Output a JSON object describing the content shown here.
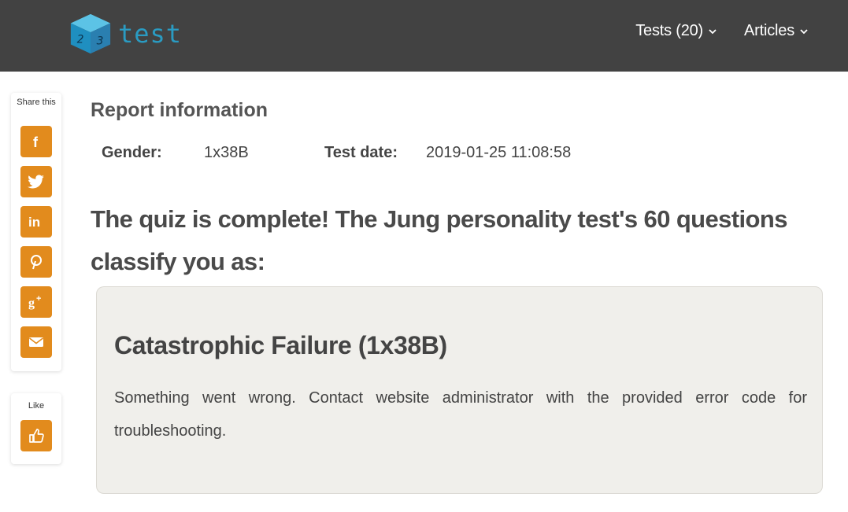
{
  "header": {
    "logo_text": "test",
    "logo_digits": [
      "2",
      "3"
    ],
    "nav": [
      {
        "label": "Tests (20)",
        "icon": "chevron-down-icon"
      },
      {
        "label": "Articles",
        "icon": "chevron-down-icon"
      }
    ],
    "background_color": "#424242",
    "logo_color": "#2a9bc2"
  },
  "share_sidebar": {
    "label": "Share this",
    "buttons": [
      {
        "name": "facebook",
        "icon": "facebook-icon"
      },
      {
        "name": "twitter",
        "icon": "twitter-icon"
      },
      {
        "name": "linkedin",
        "icon": "linkedin-icon"
      },
      {
        "name": "pinterest",
        "icon": "pinterest-icon"
      },
      {
        "name": "google-plus",
        "icon": "google-plus-icon"
      },
      {
        "name": "email",
        "icon": "email-icon"
      }
    ],
    "accent_color": "#e28b1d"
  },
  "like_panel": {
    "label": "Like",
    "icon": "thumbs-up-icon"
  },
  "report": {
    "title": "Report information",
    "gender_label": "Gender:",
    "gender_value": "1x38B",
    "date_label": "Test date:",
    "date_value": "2019-01-25 11:08:58"
  },
  "headline": "The quiz is complete! The Jung personality test's 60 questions classify you as:",
  "result": {
    "title": "Catastrophic Failure (1x38B)",
    "description": "Something went wrong. Contact website administrator with the provided error code for troubleshooting.",
    "background_color": "#f0efeb"
  }
}
